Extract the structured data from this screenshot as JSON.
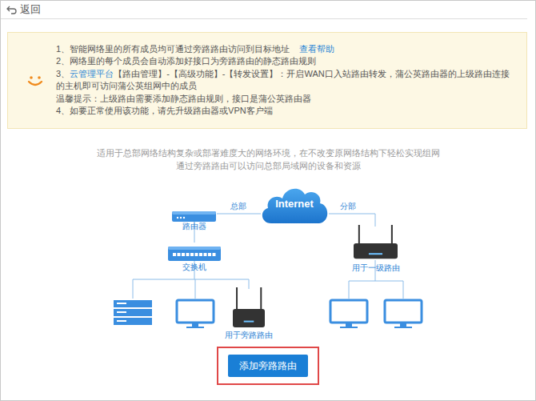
{
  "header": {
    "back": "返回"
  },
  "notice": {
    "items": [
      {
        "kind": "item",
        "parts": [
          {
            "text": "1、智能网络里的所有成员均可通过旁路路由访问到目标地址",
            "kind": "text"
          },
          {
            "text": "查看帮助",
            "kind": "link"
          }
        ]
      },
      {
        "kind": "item",
        "parts": [
          {
            "text": "2、网络里的每个成员会自动添加好接口为旁路路由的静态路由规则",
            "kind": "text"
          }
        ]
      },
      {
        "kind": "item",
        "parts": [
          {
            "text": "3、",
            "kind": "text"
          },
          {
            "text": "云管理平台",
            "kind": "link"
          },
          {
            "text": "【路由管理】-【高级功能】-【转发设置】：开启WAN口入站路由转发，蒲公英路由器的上级路由连接的主机即可访问蒲公英组网中的成员",
            "kind": "text"
          }
        ]
      },
      {
        "kind": "tip",
        "parts": [
          {
            "text": "温馨提示：上级路由需要添加静态路由规则，接口是蒲公英路由器",
            "kind": "text"
          }
        ]
      },
      {
        "kind": "item",
        "parts": [
          {
            "text": "4、如要正常使用该功能，请先升级路由器或VPN客户端",
            "kind": "text"
          }
        ]
      }
    ]
  },
  "intro": [
    "适用于总部网络结构复杂或部署难度大的网络环境，在不改变原网络结构下轻松实现组网",
    "通过旁路路由可以访问总部局域网的设备和资源"
  ],
  "diagram": {
    "cloud": "Internet",
    "hq_label": "总部",
    "branch_label": "分部",
    "nodes": [
      {
        "label": "路由器"
      },
      {
        "label": "交换机"
      },
      {
        "label": "用于旁路路由"
      },
      {
        "label": "用于一级路由"
      }
    ]
  },
  "button": {
    "label": "添加旁路路由",
    "highlighted": true
  }
}
